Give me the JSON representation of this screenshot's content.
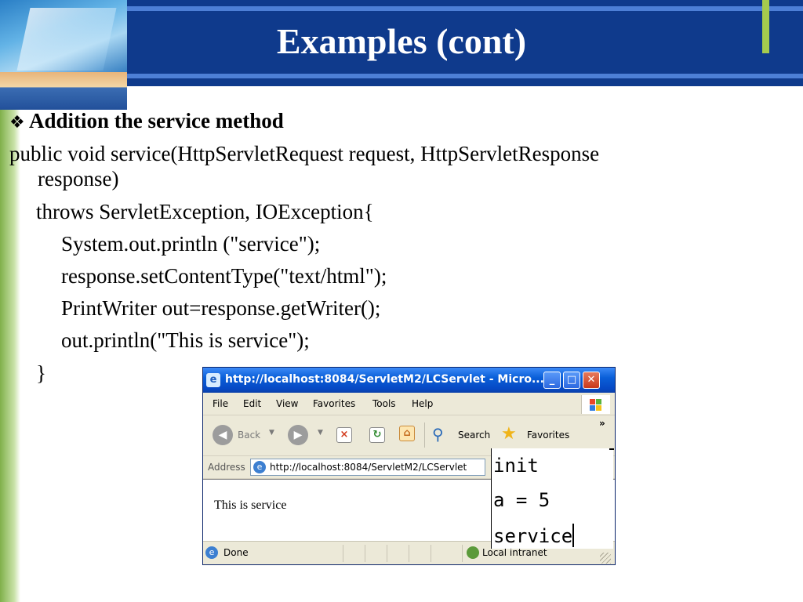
{
  "slide": {
    "title": "Examples (cont)",
    "bullet_icon": "❖",
    "bullet": "Addition the service method",
    "code_lines": [
      "public void service(HttpServletRequest request, HttpServletResponse",
      "response)",
      "throws ServletException, IOException{",
      "System.out.println (\"service\");",
      "response.setContentType(\"text/html\");",
      "PrintWriter out=response.getWriter();",
      "out.println(\"This is service\");",
      "}"
    ]
  },
  "browser": {
    "title": "http://localhost:8084/ServletM2/LCServlet - Micro...",
    "menu": [
      "File",
      "Edit",
      "View",
      "Favorites",
      "Tools",
      "Help"
    ],
    "toolbar": {
      "back_label": "Back",
      "search_label": "Search",
      "favorites_label": "Favorites",
      "chevron": "»"
    },
    "address_label": "Address",
    "address_value": "http://localhost:8084/ServletM2/LCServlet",
    "content_text": "This is service",
    "status_text": "Done",
    "zone_text": "Local intranet"
  },
  "console": {
    "lines": [
      "init",
      "a = 5",
      "service"
    ]
  },
  "colors": {
    "title_band": "#0f3a8c",
    "accent_green": "#a5cb4e",
    "xp_titlebar": "#0a5fd8"
  }
}
